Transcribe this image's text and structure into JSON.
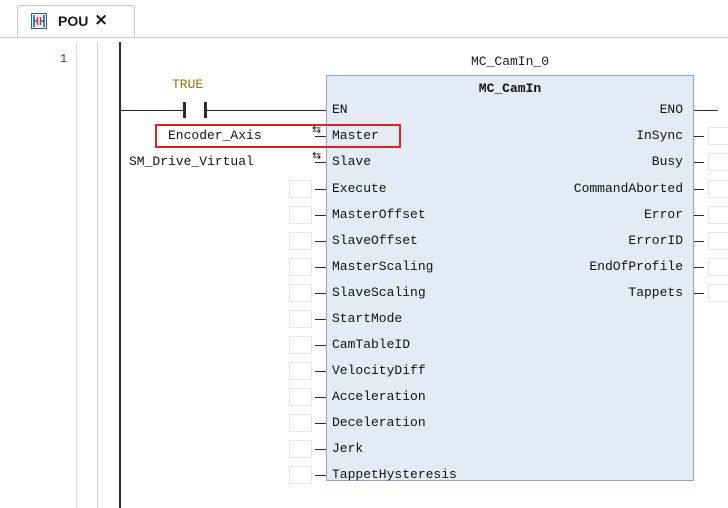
{
  "tab": {
    "label": "POU",
    "close": "×",
    "icon": "ladder-pou-icon"
  },
  "editor": {
    "line_number": "1",
    "contact_label": "TRUE",
    "fb_instance": "MC_CamIn_0",
    "fb_type": "MC_CamIn",
    "inputs": [
      {
        "name": "EN"
      },
      {
        "name": "Master",
        "connected": "Encoder_Axis"
      },
      {
        "name": "Slave",
        "connected": "SM_Drive_Virtual"
      },
      {
        "name": "Execute"
      },
      {
        "name": "MasterOffset"
      },
      {
        "name": "SlaveOffset"
      },
      {
        "name": "MasterScaling"
      },
      {
        "name": "SlaveScaling"
      },
      {
        "name": "StartMode"
      },
      {
        "name": "CamTableID"
      },
      {
        "name": "VelocityDiff"
      },
      {
        "name": "Acceleration"
      },
      {
        "name": "Deceleration"
      },
      {
        "name": "Jerk"
      },
      {
        "name": "TappetHysteresis"
      }
    ],
    "outputs": [
      {
        "name": "ENO"
      },
      {
        "name": "InSync"
      },
      {
        "name": "Busy"
      },
      {
        "name": "CommandAborted"
      },
      {
        "name": "Error"
      },
      {
        "name": "ErrorID"
      },
      {
        "name": "EndOfProfile"
      },
      {
        "name": "Tappets"
      }
    ],
    "io_arrow": "⇆"
  },
  "colors": {
    "true_label": "#8a7a10",
    "fb_fill": "#e3ecf6",
    "fb_border": "#8ea6c8",
    "highlight": "#e02020"
  }
}
